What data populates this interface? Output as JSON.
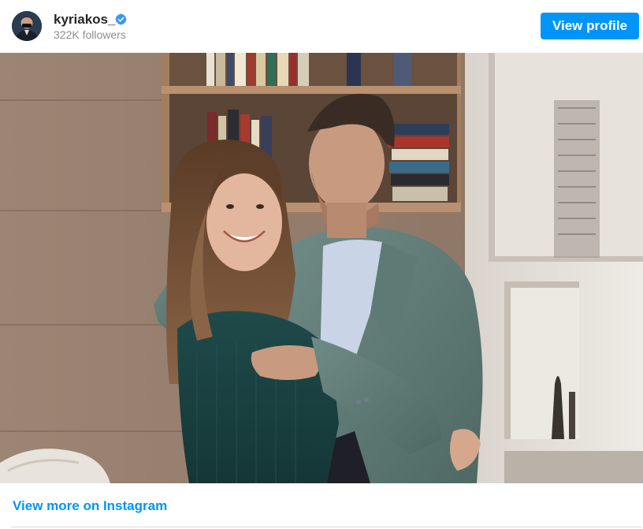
{
  "header": {
    "username": "kyriakos_",
    "followers": "322K followers",
    "view_profile_label": "View profile"
  },
  "icons": {
    "verified": "verified-badge-icon",
    "avatar": "profile-avatar"
  },
  "footer": {
    "view_more_label": "View more on Instagram"
  },
  "colors": {
    "accent": "#0095f6",
    "text_primary": "#262626",
    "text_secondary": "#8e8e8e",
    "divider": "#dbdbdb"
  }
}
